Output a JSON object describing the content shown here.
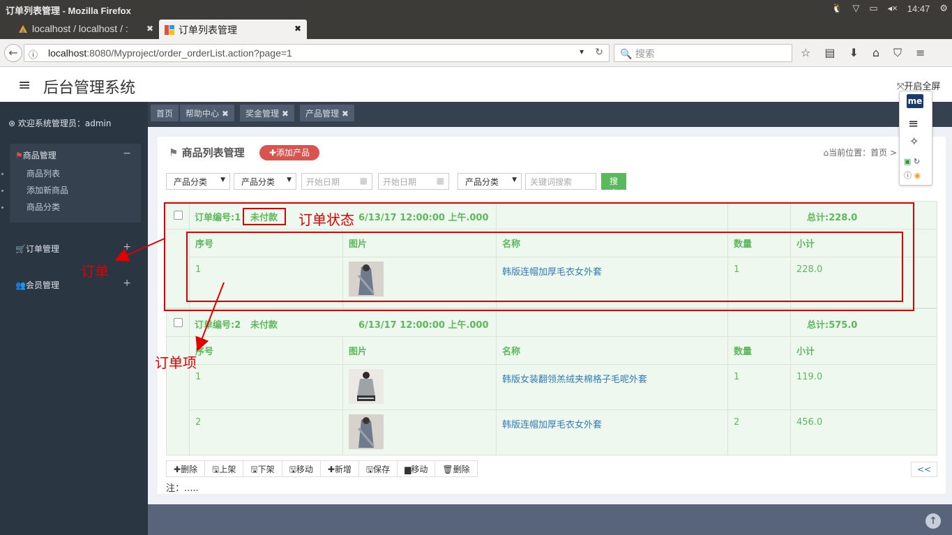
{
  "os": {
    "window_title": "订单列表管理 - Mozilla Firefox",
    "time": "14:47"
  },
  "browser": {
    "tabs": [
      {
        "label": "localhost / localhost / :",
        "close": "✖"
      },
      {
        "label": "订单列表管理",
        "close": "✖"
      }
    ],
    "new_tab": "+",
    "url_host": "localhost",
    "url_rest": ":8080/Myproject/order_orderList.action?page=1",
    "search_placeholder": "搜索"
  },
  "app": {
    "title": "后台管理系统",
    "fullscreen_label": "开启全屏"
  },
  "sidebar": {
    "welcome": "欢迎系统管理员：admin",
    "groups": [
      {
        "label": "商品管理",
        "toggle": "−",
        "items": [
          "商品列表",
          "添加新商品",
          "商品分类"
        ]
      },
      {
        "label": "订单管理",
        "toggle": "+"
      },
      {
        "label": "会员管理",
        "toggle": "+"
      }
    ]
  },
  "breadcrumb_tabs": [
    "首页",
    "帮助中心 ✖",
    "奖金管理 ✖",
    "产品管理 ✖"
  ],
  "panel": {
    "title": "商品列表管理",
    "add_button": "添加产品",
    "location_label": "当前位置：首页 >"
  },
  "filters": {
    "selects": [
      "产品分类",
      "产品分类",
      "产品分类"
    ],
    "date_placeholders": [
      "开始日期",
      "开始日期"
    ],
    "keyword_placeholder": "关键词搜索",
    "search_button": "搜索"
  },
  "orders": [
    {
      "order_no": "订单编号:1",
      "status": "未付款",
      "date": "6/13/17 12:00:00 上午.000",
      "total": "总计:228.0",
      "columns": [
        "序号",
        "图片",
        "名称",
        "数量",
        "小计"
      ],
      "items": [
        {
          "index": "1",
          "name": "韩版连帽加厚毛衣女外套",
          "qty": "1",
          "subtotal": "228.0"
        }
      ]
    },
    {
      "order_no": "订单编号:2",
      "status": "未付款",
      "date": "6/13/17 12:00:00 上午.000",
      "total": "总计:575.0",
      "columns": [
        "序号",
        "图片",
        "名称",
        "数量",
        "小计"
      ],
      "items": [
        {
          "index": "1",
          "name": "韩版女装翻领羔绒夹棉格子毛呢外套",
          "qty": "1",
          "subtotal": "119.0"
        },
        {
          "index": "2",
          "name": "韩版连帽加厚毛衣女外套",
          "qty": "2",
          "subtotal": "456.0"
        }
      ]
    }
  ],
  "toolbar": [
    "删除",
    "上架",
    "下架",
    "移动",
    "新增",
    "保存",
    "移动",
    "删除"
  ],
  "pager_prev": "<<",
  "note": "注：.....",
  "extension": {
    "badge": "me"
  },
  "annotations": {
    "order_status": "订单状态",
    "order": "订单",
    "order_item": "订单项"
  },
  "colors": {
    "sidebar_bg": "#2b3643",
    "accent_green": "#5cb85c",
    "add_button_red": "#d9534f",
    "annotation_red": "#e00000"
  }
}
